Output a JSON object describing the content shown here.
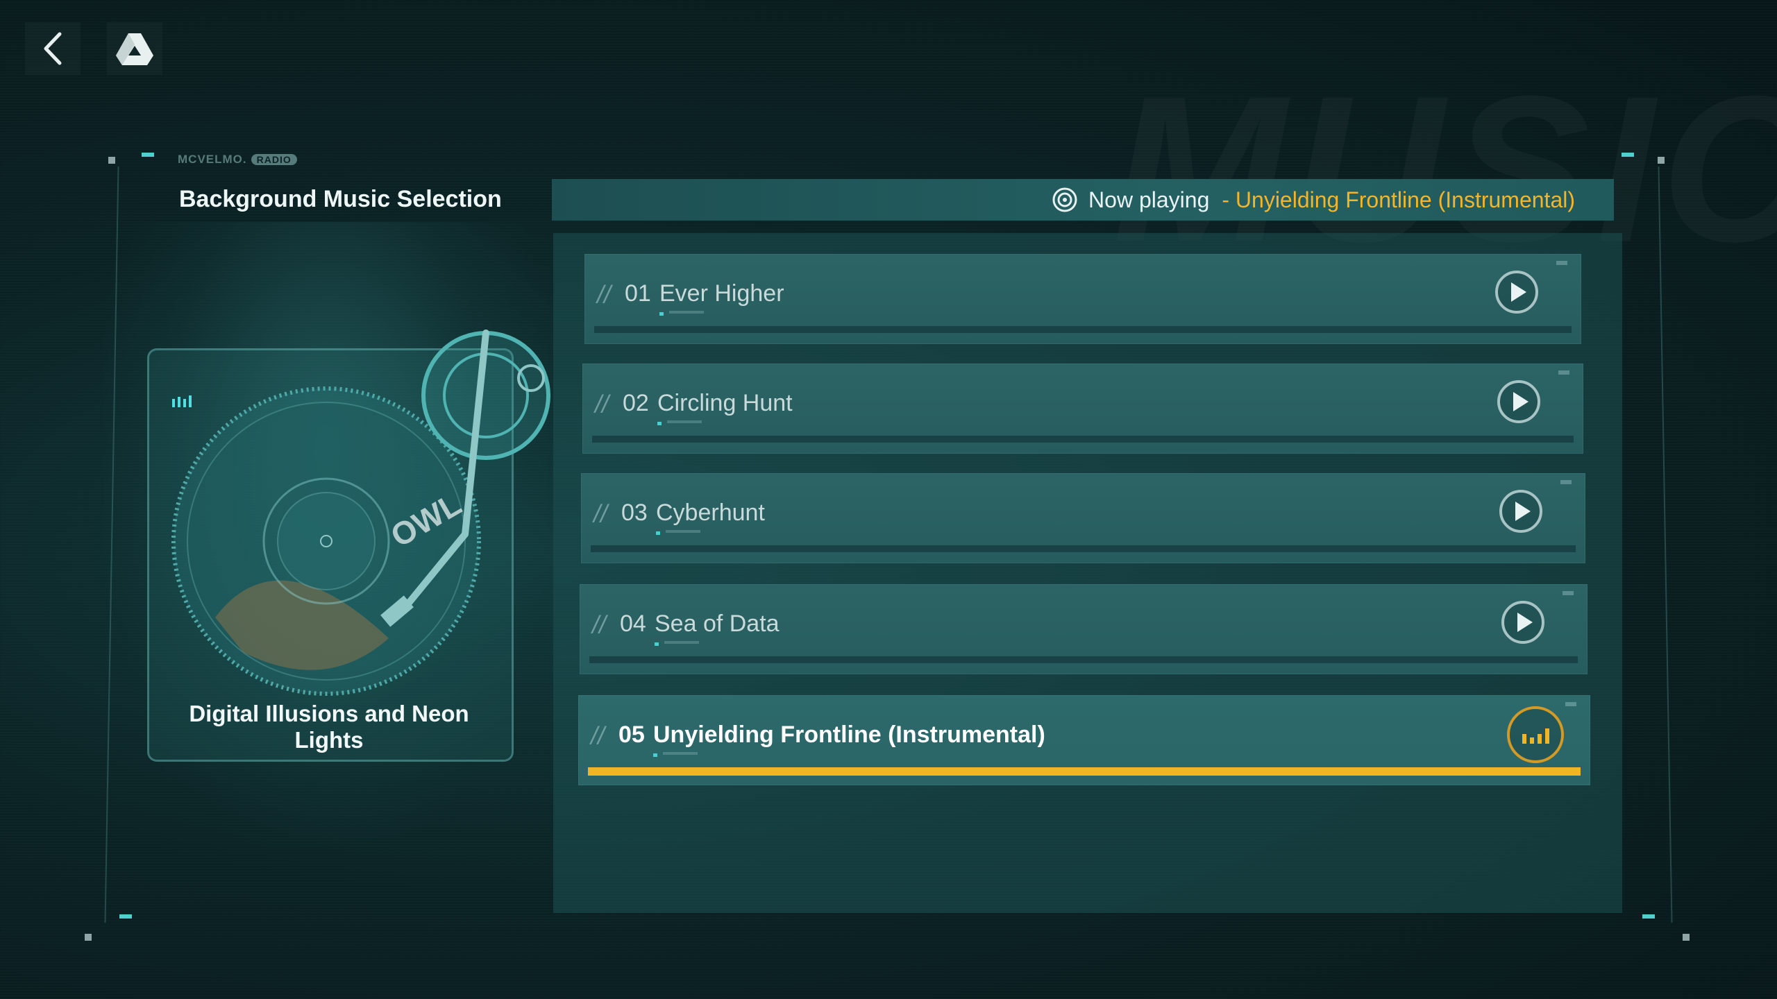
{
  "brand": {
    "name": "MCVELMO.",
    "tag": "RADIO"
  },
  "section_title": "Background Music Selection",
  "album": {
    "title": "Digital Illusions and Neon Lights"
  },
  "now_playing": {
    "label": "Now playing",
    "song": " - Unyielding Frontline (Instrumental)"
  },
  "tracks": [
    {
      "num": "01",
      "name": "Ever Higher"
    },
    {
      "num": "02",
      "name": "Circling Hunt"
    },
    {
      "num": "03",
      "name": "Cyberhunt"
    },
    {
      "num": "04",
      "name": "Sea of Data"
    },
    {
      "num": "05",
      "name": "Unyielding Frontline (Instrumental)",
      "playing": true
    }
  ],
  "watermark": "MUSIC",
  "colors": {
    "accent": "#f0b522",
    "panel": "#2c6466",
    "cyan": "#48d0d0"
  },
  "icons": {
    "back": "chevron-left-icon",
    "drive": "drive-logo-icon",
    "play": "play-icon",
    "playing": "equalizer-icon"
  }
}
